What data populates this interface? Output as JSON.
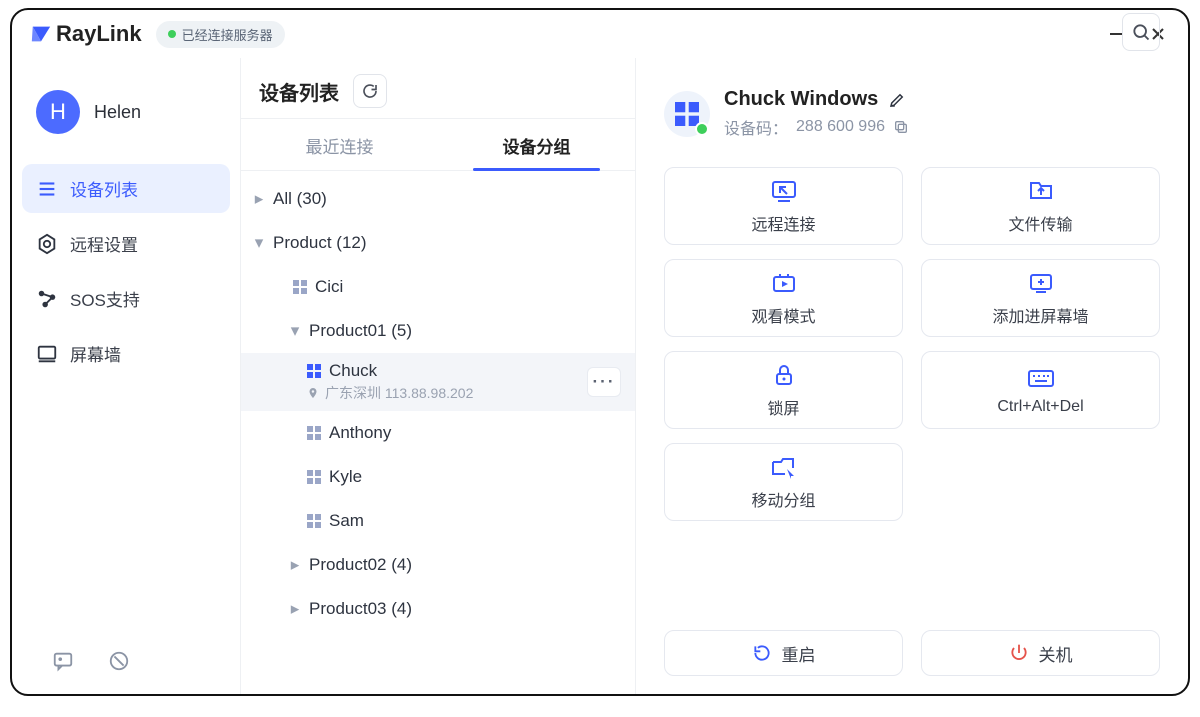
{
  "app": {
    "name": "RayLink"
  },
  "status": {
    "text": "已经连接服务器"
  },
  "user": {
    "initial": "H",
    "name": "Helen"
  },
  "nav": {
    "items": [
      {
        "label": "设备列表"
      },
      {
        "label": "远程设置"
      },
      {
        "label": "SOS支持"
      },
      {
        "label": "屏幕墙"
      }
    ]
  },
  "middle": {
    "title": "设备列表",
    "tabs": [
      {
        "label": "最近连接"
      },
      {
        "label": "设备分组"
      }
    ],
    "tree": {
      "all": "All (30)",
      "product": "Product (12)",
      "product01": "Product01 (5)",
      "product02": "Product02 (4)",
      "product03": "Product03 (4)",
      "devices": [
        "Cici",
        "Chuck",
        "Anthony",
        "Kyle",
        "Sam"
      ],
      "chuck_sub": "广东深圳 113.88.98.202"
    }
  },
  "detail": {
    "title": "Chuck Windows",
    "id_label": "设备码：",
    "id_value": "288 600 996",
    "actions": [
      "远程连接",
      "文件传输",
      "观看模式",
      "添加进屏幕墙",
      "锁屏",
      "Ctrl+Alt+Del",
      "移动分组"
    ],
    "footer": {
      "restart": "重启",
      "power": "关机"
    }
  }
}
